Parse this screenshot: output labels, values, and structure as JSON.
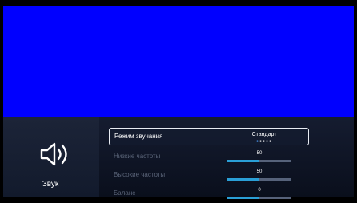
{
  "side": {
    "label": "Звук",
    "icon": "speaker-icon"
  },
  "menu": [
    {
      "id": "sound-mode",
      "label": "Режим звучания",
      "value": "Стандарт",
      "dots_total": 5,
      "dots_active": 1
    },
    {
      "id": "bass",
      "label": "Низкие частоты",
      "value": "50",
      "level": 0.5
    },
    {
      "id": "treble",
      "label": "Высокие частоты",
      "value": "50",
      "level": 0.5
    },
    {
      "id": "balance",
      "label": "Баланс",
      "value": "0",
      "level": 0.5
    }
  ],
  "colors": {
    "preview": "#0000ff",
    "accent": "#2a9fd6",
    "panel": "#0e1424"
  }
}
